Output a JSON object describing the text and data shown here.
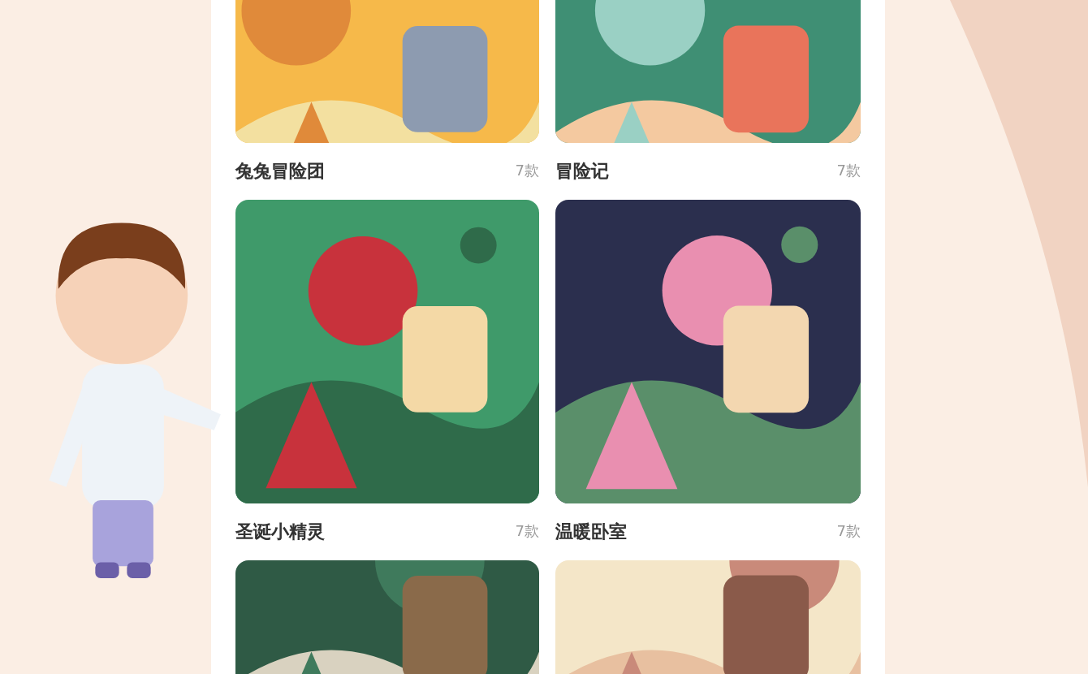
{
  "cards": [
    {
      "kind": "picture",
      "title": "兔兔冒险团",
      "count": "7款"
    },
    {
      "kind": "picture",
      "title": "冒险记",
      "count": "7款"
    },
    {
      "kind": "picture",
      "title": "圣诞小精灵",
      "count": "7款"
    },
    {
      "kind": "picture",
      "title": "温暖卧室",
      "count": "7款"
    },
    {
      "kind": "picture"
    },
    {
      "kind": "picture"
    }
  ]
}
